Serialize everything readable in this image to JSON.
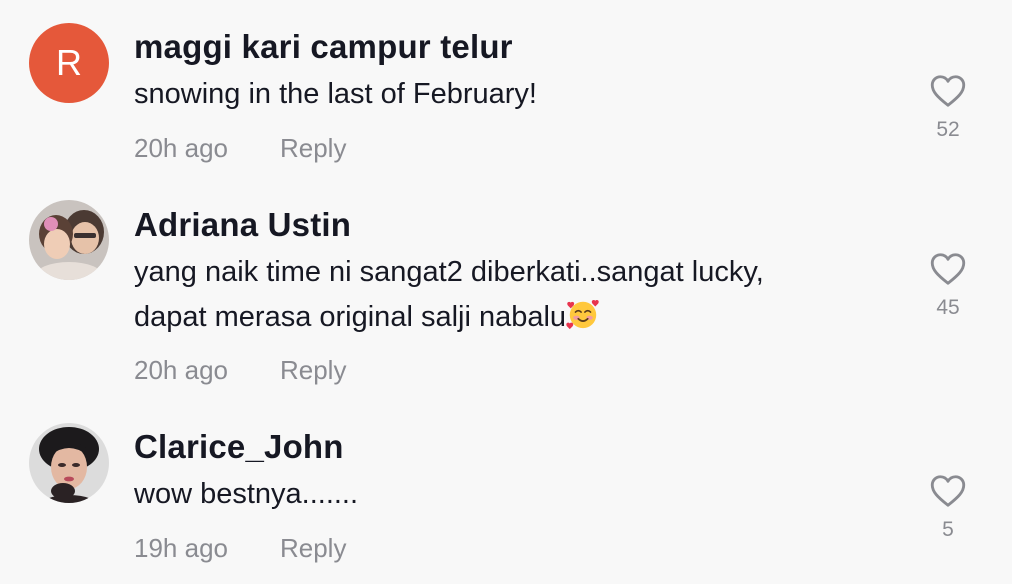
{
  "comments": [
    {
      "avatar_letter": "R",
      "username": "maggi kari campur telur",
      "lines": [
        "snowing in the last of February!"
      ],
      "time": "20h ago",
      "reply_label": "Reply",
      "likes": "52",
      "avatar_color": "#e5583a"
    },
    {
      "username": "Adriana Ustin",
      "lines": [
        "yang naik time ni sangat2 diberkati..sangat lucky,",
        "dapat merasa original salji nabalu"
      ],
      "emoji": "smiling-face-with-hearts",
      "time": "20h ago",
      "reply_label": "Reply",
      "likes": "45"
    },
    {
      "username": "Clarice_John",
      "lines": [
        "wow bestnya......."
      ],
      "time": "19h ago",
      "reply_label": "Reply",
      "likes": "5"
    }
  ],
  "colors": {
    "background": "#f8f8f8",
    "text_primary": "#161823",
    "text_secondary": "#8a8b91"
  }
}
